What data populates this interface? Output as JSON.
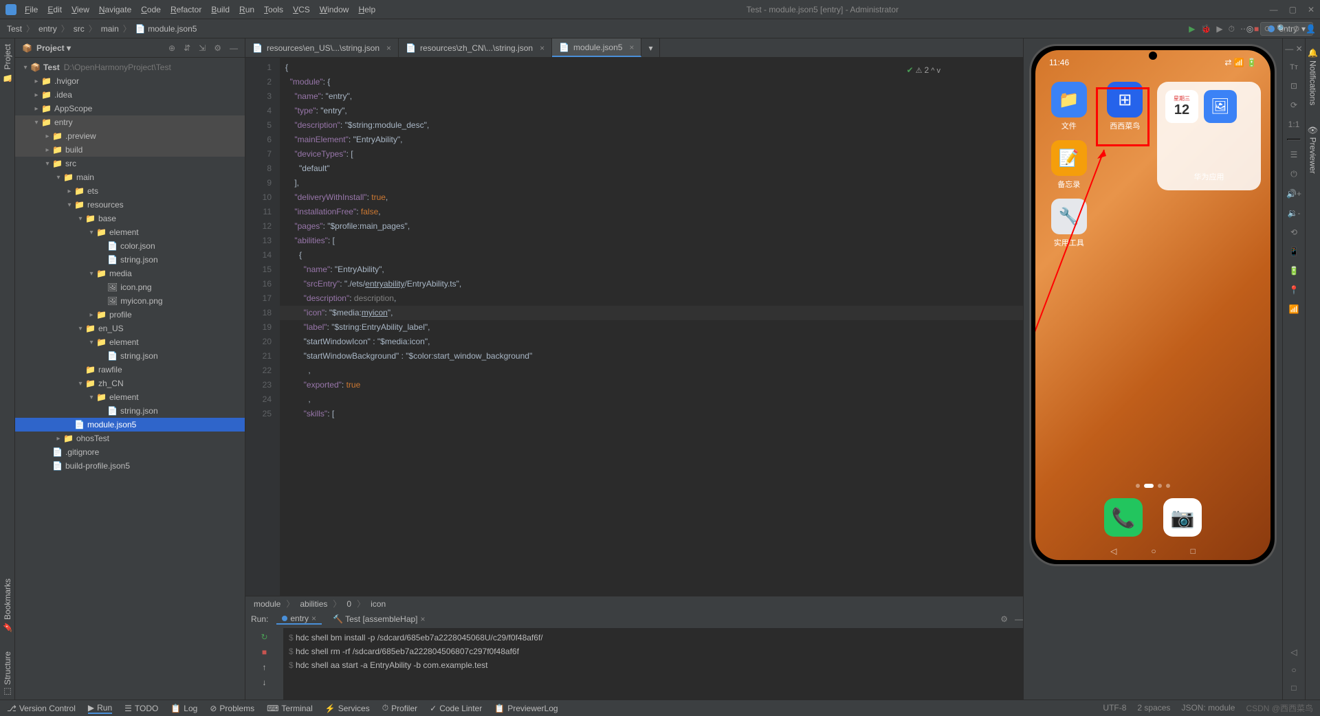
{
  "window": {
    "title": "Test - module.json5 [entry] - Administrator",
    "menu": [
      "File",
      "Edit",
      "View",
      "Navigate",
      "Code",
      "Refactor",
      "Build",
      "Run",
      "Tools",
      "VCS",
      "Window",
      "Help"
    ]
  },
  "breadcrumb": [
    "Test",
    "entry",
    "src",
    "main",
    "module.json5"
  ],
  "run_config": "entry",
  "project": {
    "label": "Project",
    "root": "Test",
    "root_path": "D:\\OpenHarmonyProject\\Test",
    "tree": [
      {
        "d": 1,
        "c": "▸",
        "i": "📁",
        "n": ".hvigor"
      },
      {
        "d": 1,
        "c": "▸",
        "i": "📁",
        "n": ".idea"
      },
      {
        "d": 1,
        "c": "▸",
        "i": "📁",
        "n": "AppScope"
      },
      {
        "d": 1,
        "c": "▾",
        "i": "📁",
        "n": "entry",
        "dim": true
      },
      {
        "d": 2,
        "c": "▸",
        "i": "📁",
        "n": ".preview",
        "fold": true,
        "dim": true
      },
      {
        "d": 2,
        "c": "▸",
        "i": "📁",
        "n": "build",
        "fold": true,
        "dim": true
      },
      {
        "d": 2,
        "c": "▾",
        "i": "📁",
        "n": "src"
      },
      {
        "d": 3,
        "c": "▾",
        "i": "📁",
        "n": "main"
      },
      {
        "d": 4,
        "c": "▸",
        "i": "📁",
        "n": "ets"
      },
      {
        "d": 4,
        "c": "▾",
        "i": "📁",
        "n": "resources"
      },
      {
        "d": 5,
        "c": "▾",
        "i": "📁",
        "n": "base"
      },
      {
        "d": 6,
        "c": "▾",
        "i": "📁",
        "n": "element"
      },
      {
        "d": 7,
        "c": "",
        "i": "📄",
        "n": "color.json"
      },
      {
        "d": 7,
        "c": "",
        "i": "📄",
        "n": "string.json"
      },
      {
        "d": 6,
        "c": "▾",
        "i": "📁",
        "n": "media"
      },
      {
        "d": 7,
        "c": "",
        "i": "🖼",
        "n": "icon.png"
      },
      {
        "d": 7,
        "c": "",
        "i": "🖼",
        "n": "myicon.png"
      },
      {
        "d": 6,
        "c": "▸",
        "i": "📁",
        "n": "profile"
      },
      {
        "d": 5,
        "c": "▾",
        "i": "📁",
        "n": "en_US"
      },
      {
        "d": 6,
        "c": "▾",
        "i": "📁",
        "n": "element"
      },
      {
        "d": 7,
        "c": "",
        "i": "📄",
        "n": "string.json"
      },
      {
        "d": 5,
        "c": "",
        "i": "📁",
        "n": "rawfile"
      },
      {
        "d": 5,
        "c": "▾",
        "i": "📁",
        "n": "zh_CN"
      },
      {
        "d": 6,
        "c": "▾",
        "i": "📁",
        "n": "element"
      },
      {
        "d": 7,
        "c": "",
        "i": "📄",
        "n": "string.json"
      },
      {
        "d": 4,
        "c": "",
        "i": "📄",
        "n": "module.json5",
        "sel": true
      },
      {
        "d": 3,
        "c": "▸",
        "i": "📁",
        "n": "ohosTest"
      },
      {
        "d": 2,
        "c": "",
        "i": "📄",
        "n": ".gitignore"
      },
      {
        "d": 2,
        "c": "",
        "i": "📄",
        "n": "build-profile.json5"
      }
    ]
  },
  "tabs": [
    {
      "label": "resources\\en_US\\...\\string.json",
      "active": false
    },
    {
      "label": "resources\\zh_CN\\...\\string.json",
      "active": false
    },
    {
      "label": "module.json5",
      "active": true
    }
  ],
  "editor": {
    "problems_badge": "2",
    "current_line": 18,
    "lines": [
      "{",
      "  \"module\": {",
      "    \"name\": \"entry\",",
      "    \"type\": \"entry\",",
      "    \"description\": \"$string:module_desc\",",
      "    \"mainElement\": \"EntryAbility\",",
      "    \"deviceTypes\": [",
      "      \"default\"",
      "    ],",
      "    \"deliveryWithInstall\": true,",
      "    \"installationFree\": false,",
      "    \"pages\": \"$profile:main_pages\",",
      "    \"abilities\": [",
      "      {",
      "        \"name\": \"EntryAbility\",",
      "        \"srcEntry\": \"./ets/entryability/EntryAbility.ts\",",
      "        \"description\": description,",
      "        \"icon\": \"$media:myicon\",",
      "        \"label\": \"$string:EntryAbility_label\",",
      "        \"startWindowIcon\" : \"$media:icon\",",
      "        \"startWindowBackground\" : \"$color:start_window_background\"",
      "          ,",
      "        \"exported\": true",
      "          ,",
      "        \"skills\": ["
    ],
    "crumb": [
      "module",
      "abilities",
      "0",
      "icon"
    ]
  },
  "run": {
    "label": "Run:",
    "tabs": [
      {
        "n": "entry",
        "a": true
      },
      {
        "n": "Test [assembleHap]",
        "a": false
      }
    ],
    "lines": [
      "$ hdc shell bm install -p /sdcard/685eb7a2228045068U/c29/f0f48af6f/",
      "$ hdc shell rm -rf /sdcard/685eb7a222804506807c297f0f48af6f",
      "$ hdc shell aa start -a EntryAbility -b com.example.test"
    ]
  },
  "bottom_tools": [
    "Version Control",
    "Run",
    "TODO",
    "Log",
    "Problems",
    "Terminal",
    "Services",
    "Profiler",
    "Code Linter",
    "PreviewerLog"
  ],
  "status": {
    "encoding": "UTF-8",
    "indent": "2 spaces",
    "lang": "JSON: module"
  },
  "phone": {
    "time": "11:46",
    "apps": [
      {
        "n": "文件",
        "c": "#3b82f6",
        "e": "📁"
      },
      {
        "n": "西西菜鸟",
        "c": "#2563eb",
        "e": "⊞",
        "hl": true
      },
      {
        "n": "备忘录",
        "c": "#f59e0b",
        "e": "📝"
      },
      {
        "n": "实用工具",
        "c": "#e5e7eb",
        "e": "🔧"
      }
    ],
    "widget": {
      "date": "12",
      "cal": "📅"
    },
    "widget_label": "华为应用"
  },
  "left_labels": [
    "Project",
    "Bookmarks",
    "Structure"
  ],
  "right_labels": [
    "Notifications",
    "Previewer"
  ],
  "watermark": "CSDN @西西菜鸟"
}
